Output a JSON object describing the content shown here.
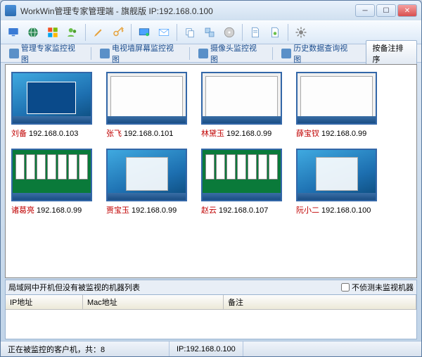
{
  "window": {
    "title": "WorkWin管理专家管理端 - 旗舰版 IP:192.168.0.100"
  },
  "tabs": {
    "t1": "管理专家监控视图",
    "t2": "电视墙屏幕监控视图",
    "t3": "摄像头监控视图",
    "t4": "历史数据查询视图",
    "sort": "按备注排序"
  },
  "clients": [
    {
      "name": "刘备",
      "ip": "192.168.0.103",
      "style": "win7desk"
    },
    {
      "name": "张飞",
      "ip": "192.168.0.101",
      "style": "browser"
    },
    {
      "name": "林黛玉",
      "ip": "192.168.0.99",
      "style": "browser"
    },
    {
      "name": "薛宝钗",
      "ip": "192.168.0.99",
      "style": "browser"
    },
    {
      "name": "诸葛亮",
      "ip": "192.168.0.99",
      "style": "solitaire"
    },
    {
      "name": "贾宝玉",
      "ip": "192.168.0.99",
      "style": "win7"
    },
    {
      "name": "赵云",
      "ip": "192.168.0.107",
      "style": "solitaire"
    },
    {
      "name": "阮小二",
      "ip": "192.168.0.100",
      "style": "win7"
    }
  ],
  "lower": {
    "header": "局域网中开机但没有被监视的机器列表",
    "checkbox": "不侦测未监视机器",
    "col_ip": "IP地址",
    "col_mac": "Mac地址",
    "col_note": "备注"
  },
  "status": {
    "left": "正在被监控的客户机，共：8",
    "right": "IP:192.168.0.100"
  },
  "icons": {
    "monitor": "monitor-icon",
    "globe": "globe-icon",
    "windows": "windows-icon",
    "users": "users-icon",
    "brush": "brush-icon",
    "key": "key-icon",
    "screen": "screen-icon",
    "mail": "mail-icon",
    "copy": "copy-icon",
    "dup": "duplicate-icon",
    "disc": "disc-icon",
    "doc1": "document-icon",
    "doc2": "document2-icon",
    "gear": "gear-icon"
  }
}
